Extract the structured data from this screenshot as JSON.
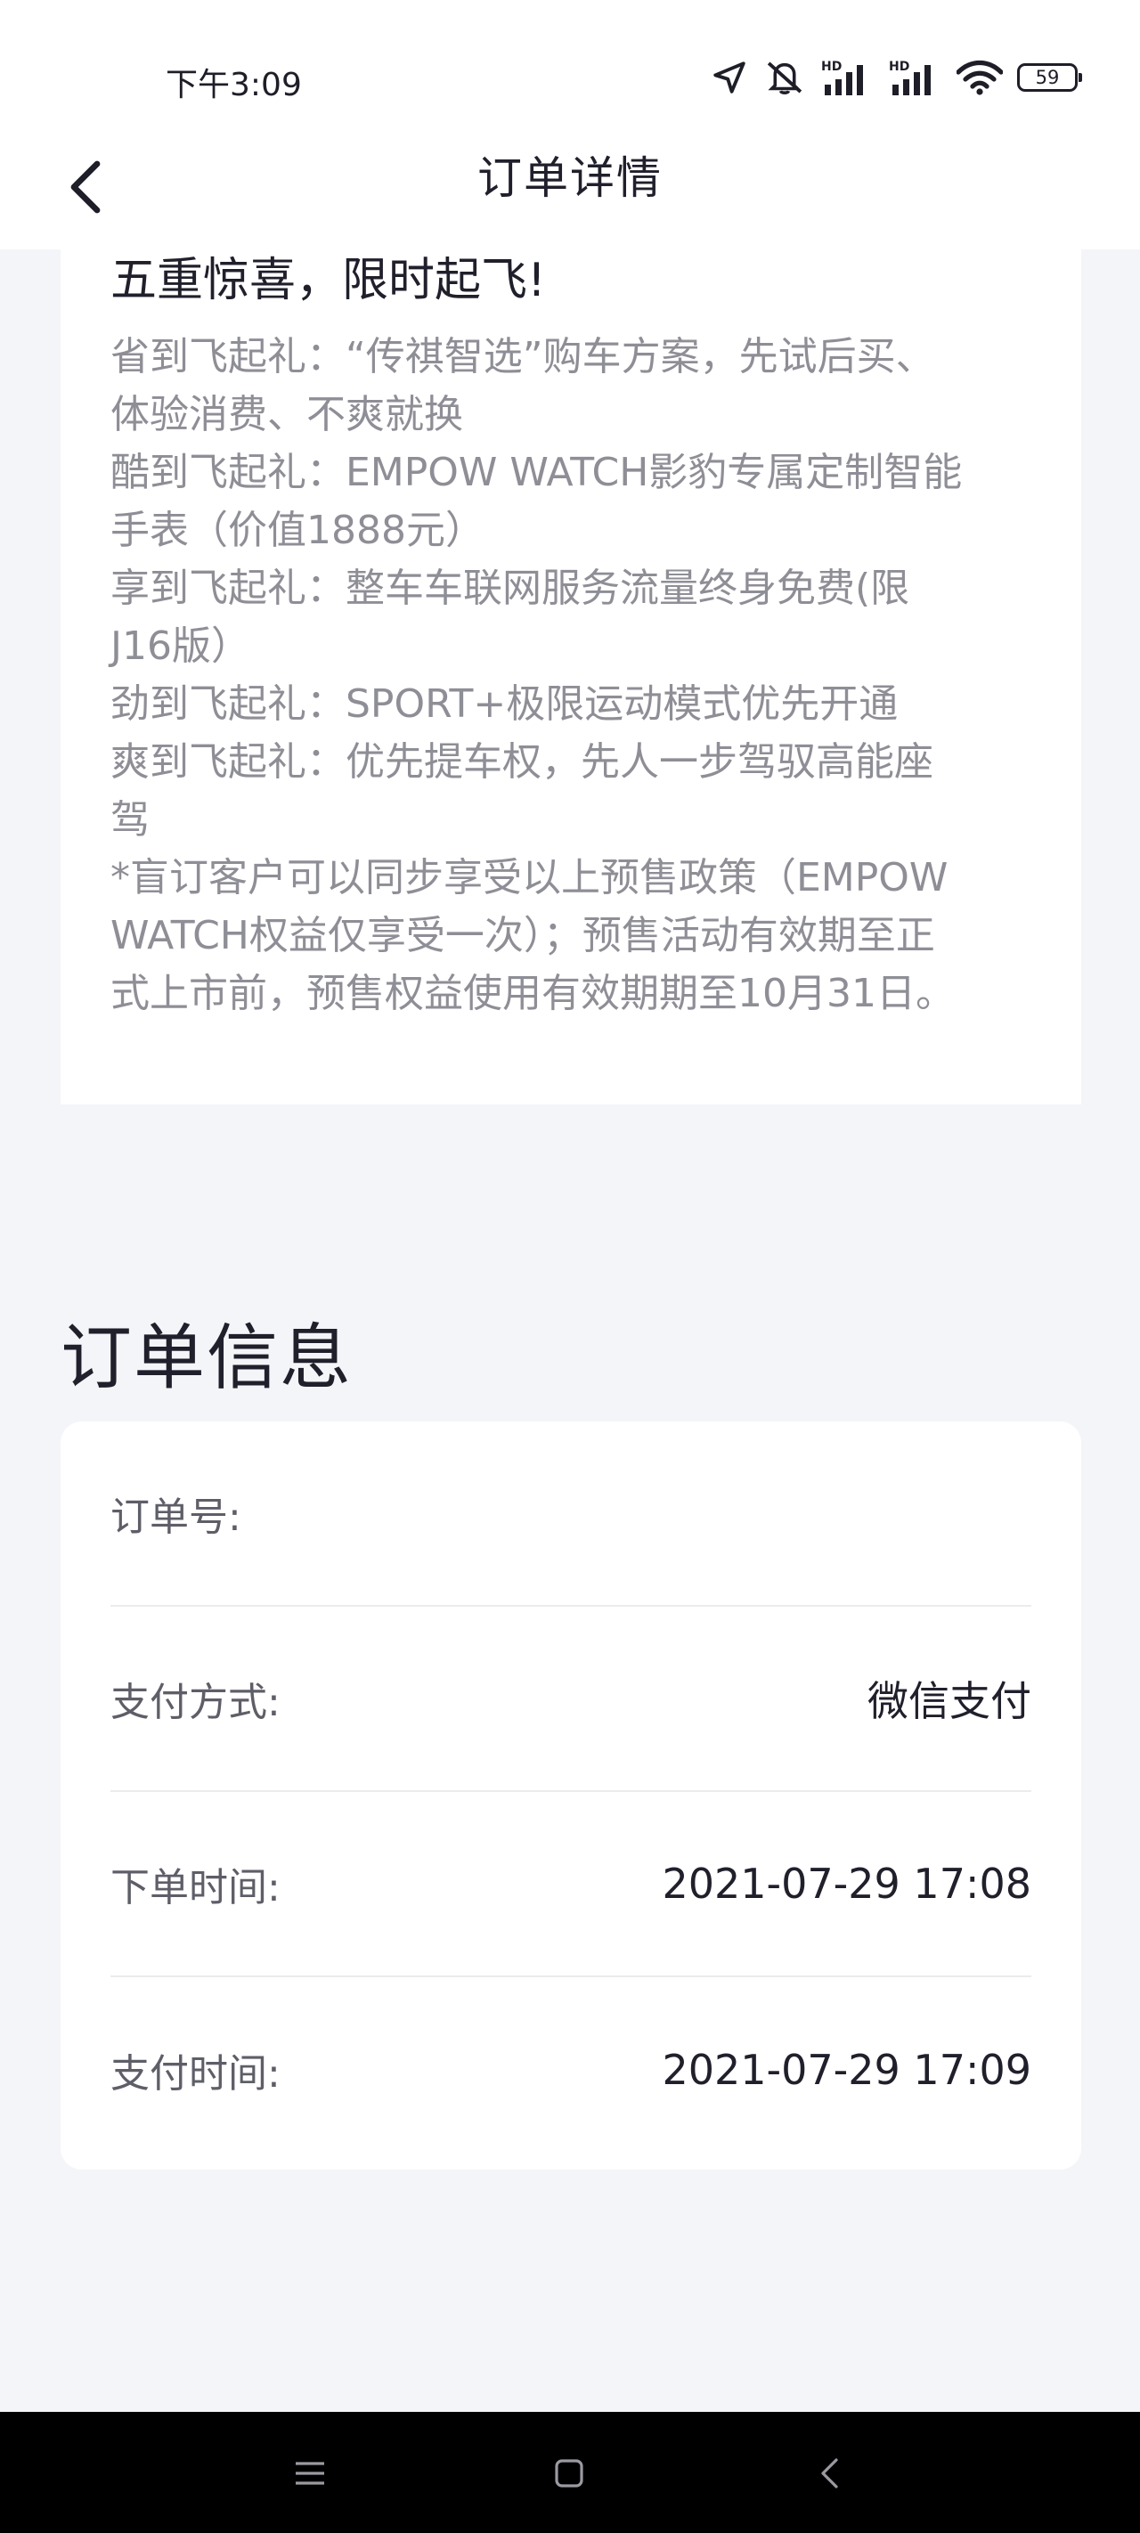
{
  "status_bar": {
    "time": "下午3:09",
    "battery": "59",
    "icons": [
      "location-icon",
      "mute-icon",
      "signal-icon",
      "signal-icon",
      "wifi-icon",
      "battery-icon"
    ]
  },
  "header": {
    "title": "订单详情",
    "back_icon": "chevron-left-icon"
  },
  "promo": {
    "title": "五重惊喜，限时起飞!",
    "lines": [
      "省到飞起礼：“传祺智选”购车方案，先试后买、",
      "体验消费、不爽就换",
      "酷到飞起礼：EMPOW WATCH影豹专属定制智能",
      "手表（价值1888元）",
      "享到飞起礼：整车车联网服务流量终身免费(限",
      "J16版）",
      "劲到飞起礼：SPORT+极限运动模式优先开通",
      "爽到飞起礼：优先提车权，先人一步驾驭高能座",
      "驾",
      "*盲订客户可以同步享受以上预售政策（EMPOW",
      "WATCH权益仅享受一次）；预售活动有效期至正",
      "式上市前，预售权益使用有效期期至10月31日。"
    ]
  },
  "order_info": {
    "title": "订单信息",
    "rows": [
      {
        "label": "订单号:",
        "value": ""
      },
      {
        "label": "支付方式:",
        "value": "微信支付"
      },
      {
        "label": "下单时间:",
        "value": "2021-07-29 17:08"
      },
      {
        "label": "支付时间:",
        "value": "2021-07-29 17:09"
      }
    ]
  },
  "nav": {
    "icons": [
      "menu-icon",
      "home-icon",
      "back-icon"
    ]
  },
  "colors": {
    "background": "#f4f5f8",
    "card": "#ffffff",
    "text_primary": "#20202c",
    "text_muted": "#8e8e96",
    "nav_bar": "#000000"
  }
}
